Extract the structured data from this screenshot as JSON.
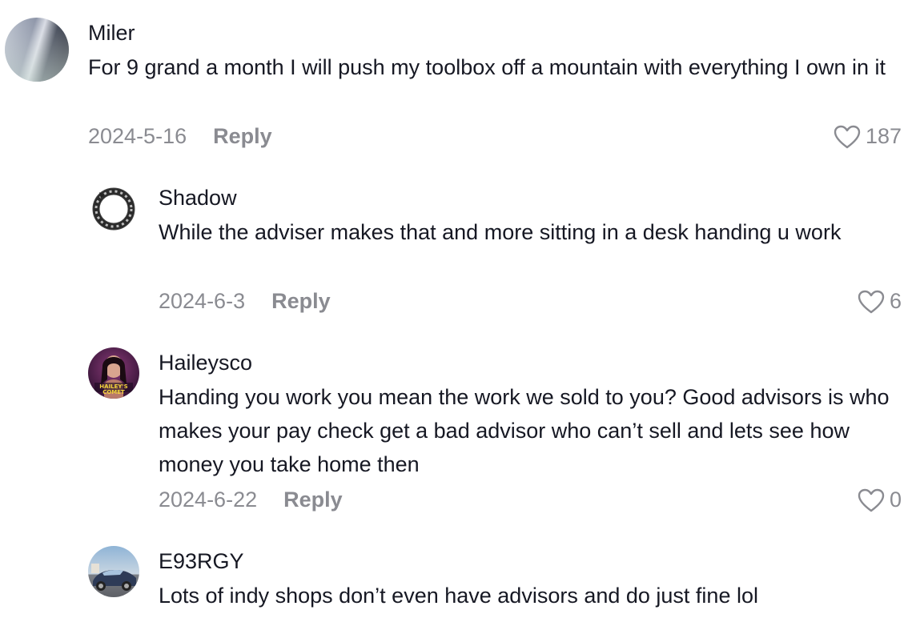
{
  "comments": [
    {
      "username": "Miler",
      "text": "For 9 grand a month I will push my toolbox off a mountain with everything I own in it",
      "date": "2024-5-16",
      "reply_label": "Reply",
      "likes": "187",
      "avatar_icon": "blurred-gradient-avatar"
    },
    {
      "username": "Shadow",
      "text": "While the adviser makes that and more sitting in a desk handing u work",
      "date": "2024-6-3",
      "reply_label": "Reply",
      "likes": "6",
      "avatar_icon": "ouroboros-ring-avatar"
    },
    {
      "username": "Haileysco",
      "text": "Handing you work you mean the work we sold to you? Good advisors is who makes your pay check get a bad advisor who can’t sell and lets see how money you take home then",
      "date": "2024-6-22",
      "reply_label": "Reply",
      "likes": "0",
      "avatar_icon": "portrait-avatar",
      "avatar_text": "HAILEY'S COMET"
    },
    {
      "username": "E93RGY",
      "text": "Lots of indy shops don’t even have advisors and do just fine lol",
      "avatar_icon": "car-photo-avatar"
    }
  ],
  "colors": {
    "text": "#161823",
    "secondary": "#8a8b91",
    "background": "#ffffff"
  }
}
